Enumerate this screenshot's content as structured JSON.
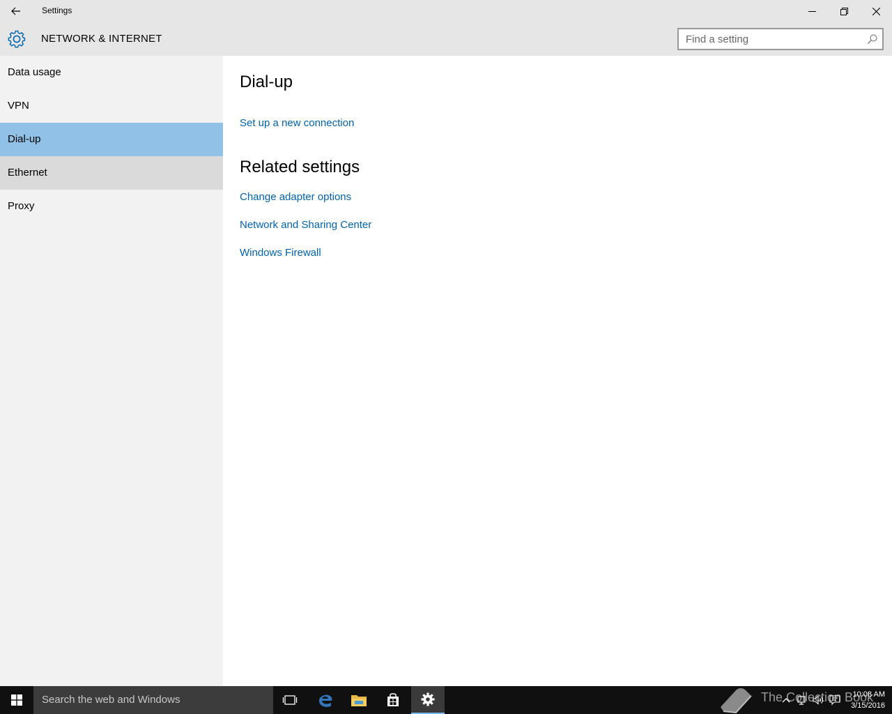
{
  "window": {
    "title": "Settings",
    "controls": {
      "minimize": "minimize-icon",
      "restore": "restore-icon",
      "close": "close-icon"
    }
  },
  "header": {
    "icon": "gear-icon",
    "title": "NETWORK & INTERNET",
    "search": {
      "placeholder": "Find a setting",
      "value": "",
      "icon": "search-icon"
    }
  },
  "sidebar": {
    "items": [
      {
        "label": "Data usage",
        "state": "normal"
      },
      {
        "label": "VPN",
        "state": "normal"
      },
      {
        "label": "Dial-up",
        "state": "selected"
      },
      {
        "label": "Ethernet",
        "state": "hover"
      },
      {
        "label": "Proxy",
        "state": "normal"
      }
    ]
  },
  "main": {
    "heading": "Dial-up",
    "setup_link": "Set up a new connection",
    "related_heading": "Related settings",
    "related_links": [
      "Change adapter options",
      "Network and Sharing Center",
      "Windows Firewall"
    ]
  },
  "taskbar": {
    "search_placeholder": "Search the web and Windows",
    "pinned": [
      "task-view-icon",
      "edge-icon",
      "file-explorer-icon",
      "store-icon",
      "settings-icon"
    ],
    "active": "settings-icon",
    "watermark": "The Collection Book",
    "tray": [
      "chevron-up-icon",
      "network-icon",
      "volume-icon",
      "action-center-icon"
    ],
    "time": "10:08 AM",
    "date": "3/15/2016"
  },
  "colors": {
    "accent": "#0063b1",
    "selected": "#91c1e7",
    "hover": "#dadada",
    "chrome": "#e6e6e6",
    "sidebar": "#f2f2f2",
    "taskbar": "#101010"
  }
}
